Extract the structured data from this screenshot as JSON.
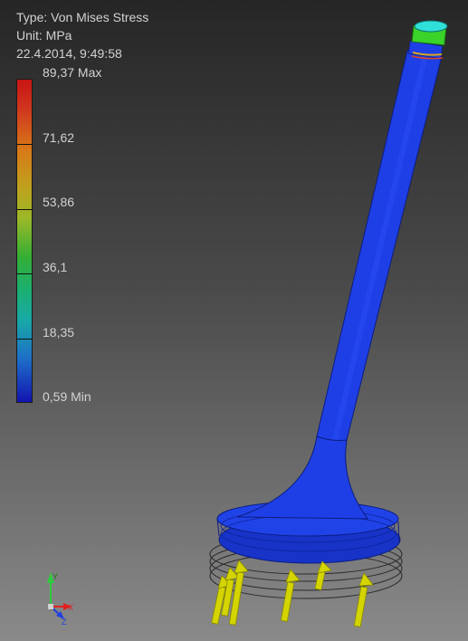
{
  "legend": {
    "type_line": "Type: Von Mises Stress",
    "unit_line": "Unit: MPa",
    "timestamp_line": "22.4.2014, 9:49:58",
    "scale_labels": [
      "89,37 Max",
      "71,62",
      "53,86",
      "36,1",
      "18,35",
      "0,59 Min"
    ],
    "scale_values": [
      89.37,
      71.62,
      53.86,
      36.1,
      18.35,
      0.59
    ]
  },
  "colors": {
    "stem": "#1f3fe6",
    "tip": "#39d32a",
    "load_arrow": "#d4d400",
    "background_top": "#262626",
    "background_bottom": "#8a8a8a"
  },
  "triad": {
    "x_label": "X",
    "y_label": "Y",
    "z_label": "Z"
  }
}
